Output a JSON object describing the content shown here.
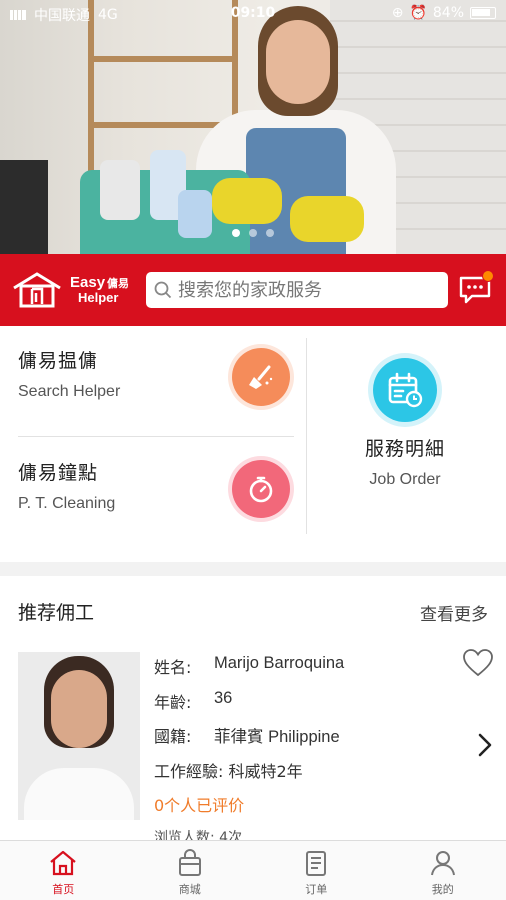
{
  "status_bar": {
    "carrier": "中国联通",
    "network": "4G",
    "time": "09:10",
    "battery": "84%"
  },
  "banner": {
    "slides": 3,
    "active_slide": 1
  },
  "header": {
    "logo_text_1": "Easy",
    "logo_text_2": "傭易",
    "logo_text_3": "Helper",
    "search_placeholder": "搜索您的家政服务",
    "accent_color": "#d7101e"
  },
  "services": [
    {
      "title": "傭易揾傭",
      "subtitle": "Search Helper",
      "icon": "broom-icon",
      "color": "#f58c5a"
    },
    {
      "title": "傭易鐘點",
      "subtitle": "P. T. Cleaning",
      "icon": "stopwatch-icon",
      "color": "#f2687a"
    },
    {
      "title": "服務明細",
      "subtitle": "Job Order",
      "icon": "calendar-icon",
      "color": "#2cc6e6"
    }
  ],
  "recommended": {
    "heading": "推荐佣工",
    "more_label": "查看更多",
    "helper": {
      "name_label": "姓名:",
      "name": "Marijo Barroquina",
      "age_label": "年齡:",
      "age": "36",
      "nationality_label": "國籍:",
      "nationality": "菲律賓 Philippine",
      "experience": "工作經驗: 科威特2年",
      "rating_text": "0个人已评价",
      "views_text": "浏览人数: 4次"
    }
  },
  "tabs": [
    {
      "label": "首页",
      "icon": "home-icon",
      "active": true
    },
    {
      "label": "商城",
      "icon": "shopping-bag-icon",
      "active": false
    },
    {
      "label": "订单",
      "icon": "order-list-icon",
      "active": false
    },
    {
      "label": "我的",
      "icon": "profile-icon",
      "active": false
    }
  ]
}
